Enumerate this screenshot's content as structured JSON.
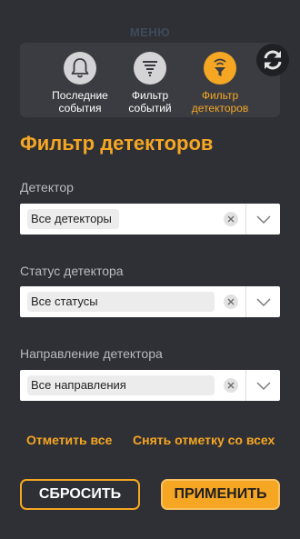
{
  "header": {
    "faint_title": "МЕНЮ"
  },
  "tabs": [
    {
      "label": "Последние события",
      "icon": "bell-icon"
    },
    {
      "label": "Фильтр событий",
      "icon": "filter-list-icon"
    },
    {
      "label": "Фильтр детекторов",
      "icon": "detector-filter-icon"
    }
  ],
  "refresh": {
    "icon": "refresh-icon"
  },
  "page": {
    "title": "Фильтр детекторов"
  },
  "fields": {
    "detector": {
      "label": "Детектор",
      "value": "Все детекторы"
    },
    "status": {
      "label": "Статус детектора",
      "value": "Все статусы"
    },
    "direction": {
      "label": "Направление детектора",
      "value": "Все направления"
    }
  },
  "actions": {
    "select_all": "Отметить все",
    "deselect_all": "Снять отметку со всех",
    "reset": "СБРОСИТЬ",
    "apply": "ПРИМЕНИТЬ"
  },
  "colors": {
    "background": "#2f3035",
    "panel": "#3b3c42",
    "accent": "#f5a623",
    "label": "#b9bbc0"
  }
}
